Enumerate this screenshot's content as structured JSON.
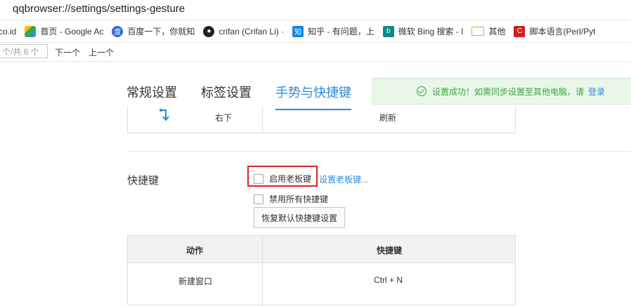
{
  "address_bar": {
    "url": "qqbrowser://settings/settings-gesture"
  },
  "bookmarks": [
    {
      "label": "co.id",
      "icon": "none"
    },
    {
      "label": "首页 - Google Ac",
      "icon": "google-ads-icon"
    },
    {
      "label": "百度一下，你就知",
      "icon": "baidu-icon"
    },
    {
      "label": "crifan (Crifan Li) ·",
      "icon": "github-icon"
    },
    {
      "label": "知乎 - 有问题，上",
      "icon": "zhihu-icon"
    },
    {
      "label": "微软 Bing 搜索 - I",
      "icon": "bing-icon"
    },
    {
      "label": "其他",
      "icon": "folder-icon"
    },
    {
      "label": "脚本语言(Perl/Pyt",
      "icon": "crifan-icon"
    }
  ],
  "find_bar": {
    "input_text": "个/共 6 个",
    "next_label": "下一个",
    "prev_label": "上一个"
  },
  "tabs": [
    {
      "label": "常规设置",
      "active": false
    },
    {
      "label": "标签设置",
      "active": false
    },
    {
      "label": "手势与快捷键",
      "active": true
    }
  ],
  "notice": {
    "text": "设置成功！如需同步设置至其他电脑，请",
    "link": "登录",
    "icon": "check-circle-icon"
  },
  "gesture_row": {
    "direction": "右下",
    "action": "刷新",
    "icon": "arrow-right-down-icon"
  },
  "shortcuts_section": {
    "label": "快捷键",
    "boss_key_checkbox": {
      "label": "启用老板键",
      "checked": false
    },
    "boss_key_link": "设置老板键...",
    "disable_all_checkbox": {
      "label": "禁用所有快捷键",
      "checked": false
    },
    "restore_button": "恢复默认快捷键设置",
    "table": {
      "headers": [
        "动作",
        "快捷键"
      ],
      "rows": [
        {
          "action": "新建窗口",
          "keys": "Ctrl + N"
        }
      ]
    }
  },
  "colors": {
    "accent": "#2b8bda",
    "success": "#3aa63a",
    "highlight": "#e02020"
  }
}
